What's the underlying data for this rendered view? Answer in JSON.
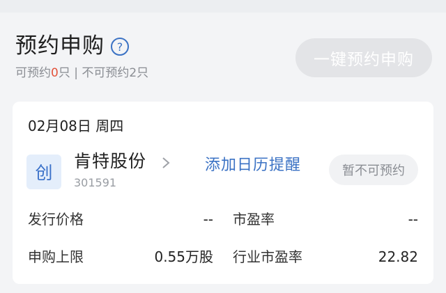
{
  "header": {
    "title": "预约申购",
    "subtitle_prefix": "可预约",
    "available_count": "0",
    "subtitle_suffix": "只 | 不可预约2只",
    "one_key_button": "一键预约申购"
  },
  "card": {
    "date": "02月08日 周四",
    "board_badge": "创",
    "stock_name": "肯特股份",
    "stock_code": "301591",
    "add_calendar": "添加日历提醒",
    "status": "暂不可预约",
    "fields": {
      "issue_price_label": "发行价格",
      "issue_price_value": "--",
      "pe_label": "市盈率",
      "pe_value": "--",
      "sub_limit_label": "申购上限",
      "sub_limit_value": "0.55万股",
      "industry_pe_label": "行业市盈率",
      "industry_pe_value": "22.82"
    }
  },
  "colors": {
    "accent_blue": "#3b72c4",
    "highlight_red": "#e2533b",
    "muted": "#8a8d93"
  }
}
